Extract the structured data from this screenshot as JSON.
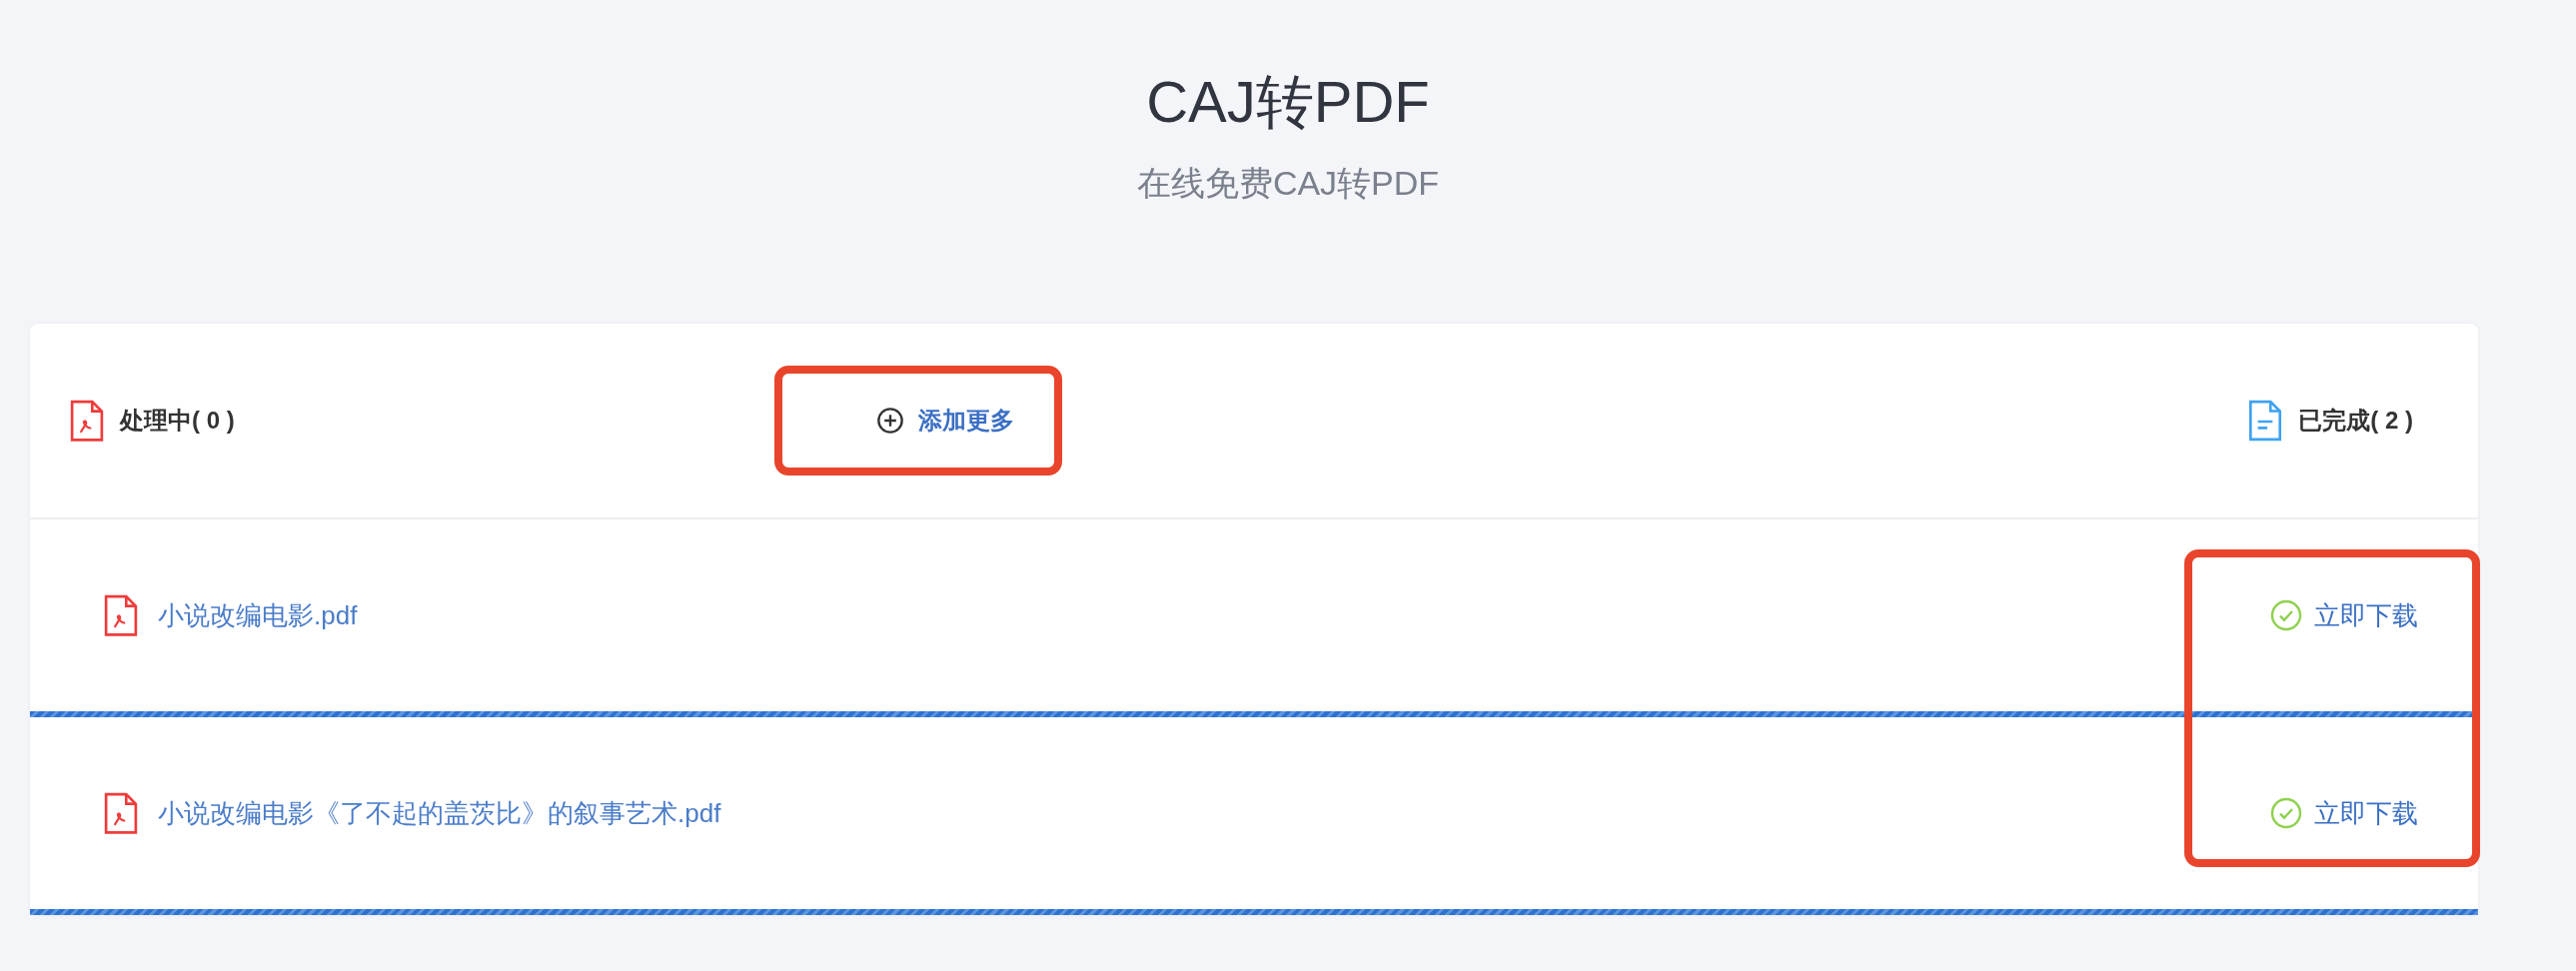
{
  "page": {
    "title": "CAJ转PDF",
    "subtitle": "在线免费CAJ转PDF"
  },
  "toolbar": {
    "processing": {
      "label": "处理中( 0 )"
    },
    "add_more": {
      "label": "添加更多",
      "highlighted": true
    },
    "completed": {
      "label": "已完成( 2 )"
    }
  },
  "files": [
    {
      "name": "小说改编电影.pdf",
      "action": "立即下载",
      "level": 1
    },
    {
      "name": "小说改编电影《了不起的盖茨比》的叙事艺术.pdf",
      "action": "立即下载",
      "level": 1
    }
  ],
  "downloads_highlighted": true
}
